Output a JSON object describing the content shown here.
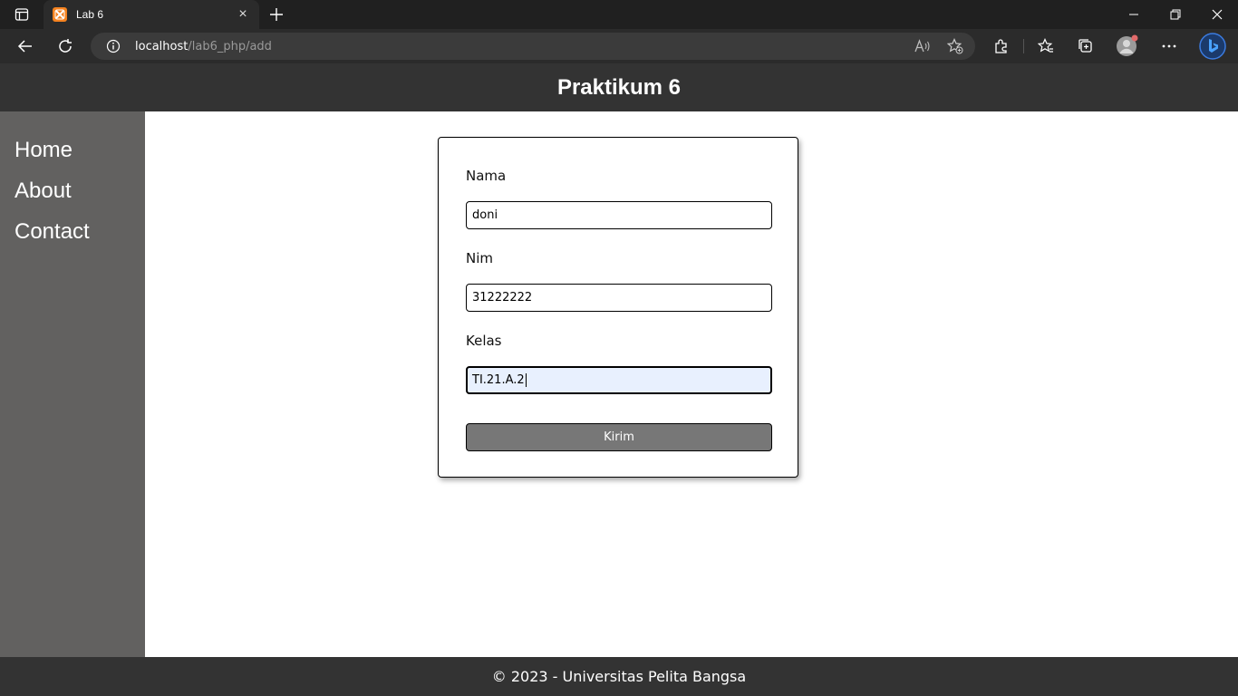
{
  "browser": {
    "tab_title": "Lab 6",
    "tab_close": "×",
    "url_host": "localhost",
    "url_path": "/lab6_php/add"
  },
  "site": {
    "title": "Praktikum 6",
    "nav": [
      "Home",
      "About",
      "Contact"
    ],
    "footer": "© 2023 - Universitas Pelita Bangsa"
  },
  "form": {
    "nama_label": "Nama",
    "nama_value": "doni",
    "nim_label": "Nim",
    "nim_value": "31222222",
    "kelas_label": "Kelas",
    "kelas_value": "TI.21.A.2",
    "submit_label": "Kirim"
  },
  "colors": {
    "header": "#333333",
    "sidebar": "#626160",
    "button": "#777777",
    "focused_field": "#e8f0fe"
  }
}
